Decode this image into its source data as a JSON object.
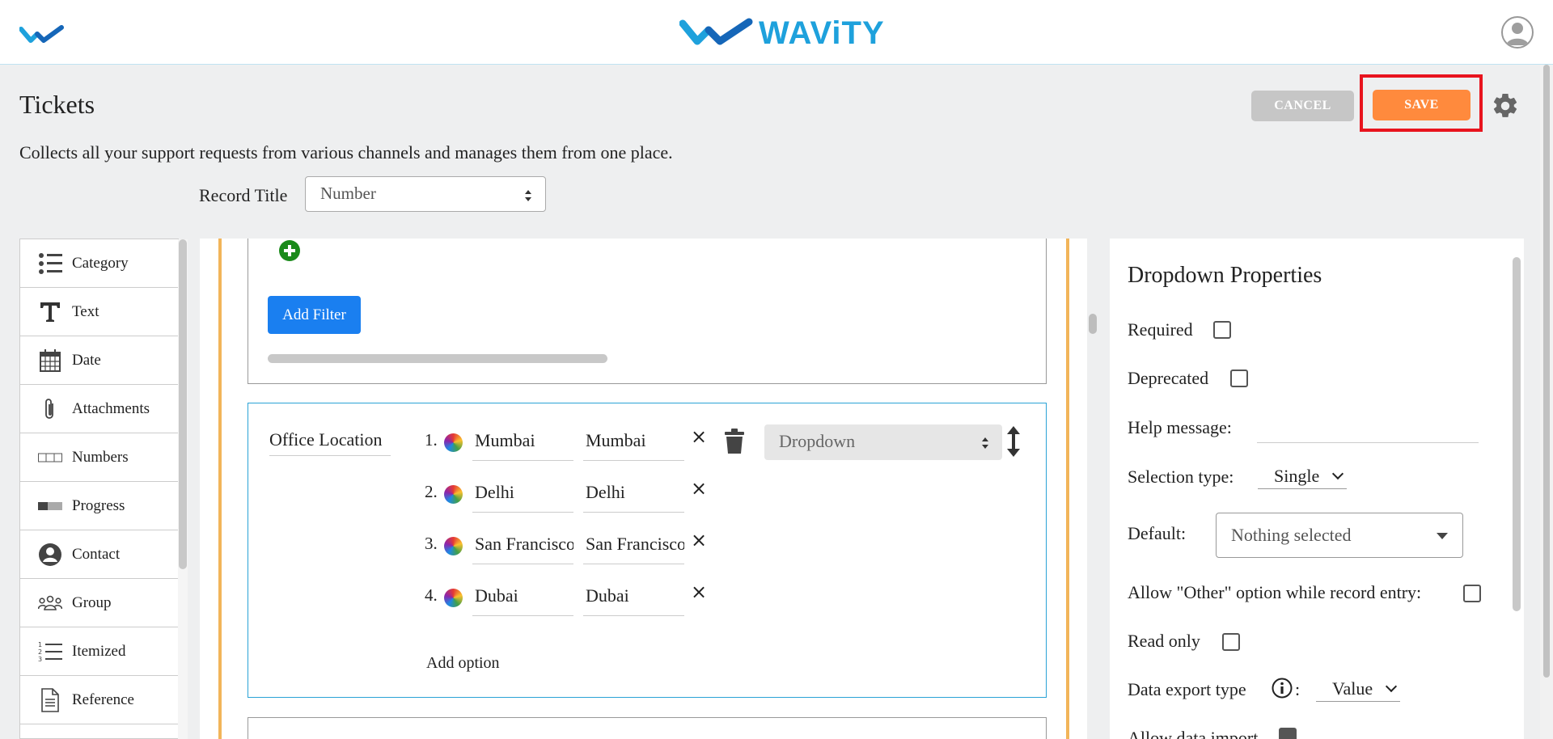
{
  "header": {
    "brand_name": "WAViTY",
    "colors": {
      "brand": "#1ea1dc",
      "save": "#ff8a3d",
      "highlight": "#e8141e",
      "cancel": "#c6c6c6"
    }
  },
  "page": {
    "title": "Tickets",
    "description": "Collects all your support requests from various channels and manages them from one place.",
    "cancel_label": "CANCEL",
    "save_label": "SAVE",
    "record_title_label": "Record Title",
    "record_title_value": "Number"
  },
  "palette": {
    "items": [
      {
        "label": "Category",
        "icon": "list-icon"
      },
      {
        "label": "Text",
        "icon": "text-t-icon"
      },
      {
        "label": "Date",
        "icon": "calendar-icon"
      },
      {
        "label": "Attachments",
        "icon": "paperclip-icon"
      },
      {
        "label": "Numbers",
        "icon": "number-boxes-icon"
      },
      {
        "label": "Progress",
        "icon": "progress-bar-icon"
      },
      {
        "label": "Contact",
        "icon": "person-circle-icon"
      },
      {
        "label": "Group",
        "icon": "group-icon"
      },
      {
        "label": "Itemized",
        "icon": "numbered-list-icon"
      },
      {
        "label": "Reference",
        "icon": "document-icon"
      }
    ]
  },
  "editor": {
    "add_filter_label": "Add Filter",
    "field_name": "Office Location",
    "options": [
      {
        "num": "1.",
        "label": "Mumbai",
        "value": "Mumbai"
      },
      {
        "num": "2.",
        "label": "Delhi",
        "value": "Delhi"
      },
      {
        "num": "3.",
        "label": "San Francisco",
        "value": "San Francisco"
      },
      {
        "num": "4.",
        "label": "Dubai",
        "value": "Dubai"
      }
    ],
    "remove_symbol": "×",
    "field_type": "Dropdown",
    "add_option_label": "Add option"
  },
  "properties": {
    "title": "Dropdown Properties",
    "required_label": "Required",
    "required": false,
    "deprecated_label": "Deprecated",
    "deprecated": false,
    "help_label": "Help message:",
    "help_value": "",
    "selection_type_label": "Selection type:",
    "selection_type": "Single",
    "default_label": "Default:",
    "default_value": "Nothing selected",
    "allow_other_label": "Allow \"Other\" option while record entry:",
    "allow_other": false,
    "read_only_label": "Read only",
    "read_only": false,
    "export_type_label": "Data export type",
    "export_colon": ":",
    "export_type": "Value",
    "allow_import_label": "Allow data import",
    "allow_import": true
  }
}
